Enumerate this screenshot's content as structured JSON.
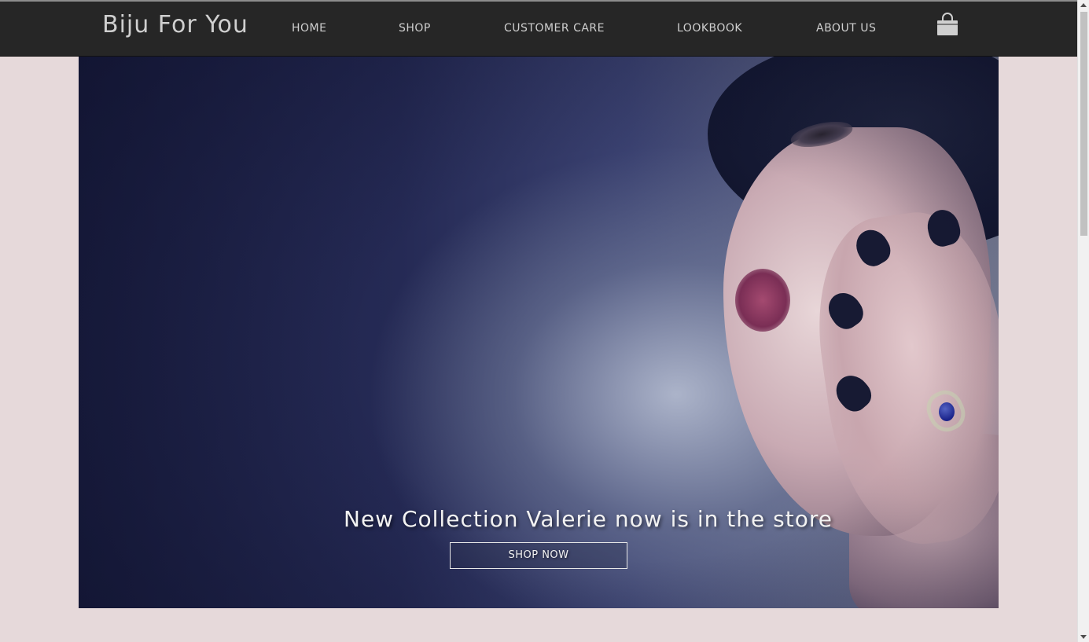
{
  "header": {
    "brand": "Biju For You",
    "nav": {
      "home": "HOME",
      "shop": "SHOP",
      "customer_care": "CUSTOMER CARE",
      "lookbook": "LOOKBOOK",
      "about_us": "ABOUT US"
    },
    "cart_icon": "shopping-bag-icon"
  },
  "hero": {
    "title": "New Collection Valerie now is in the store",
    "cta_label": "SHOP NOW"
  },
  "colors": {
    "navbar_bg": "#262626",
    "page_bg": "#e6d9da",
    "nav_text": "#cfcfcf",
    "hero_text": "#f2f2f2"
  }
}
